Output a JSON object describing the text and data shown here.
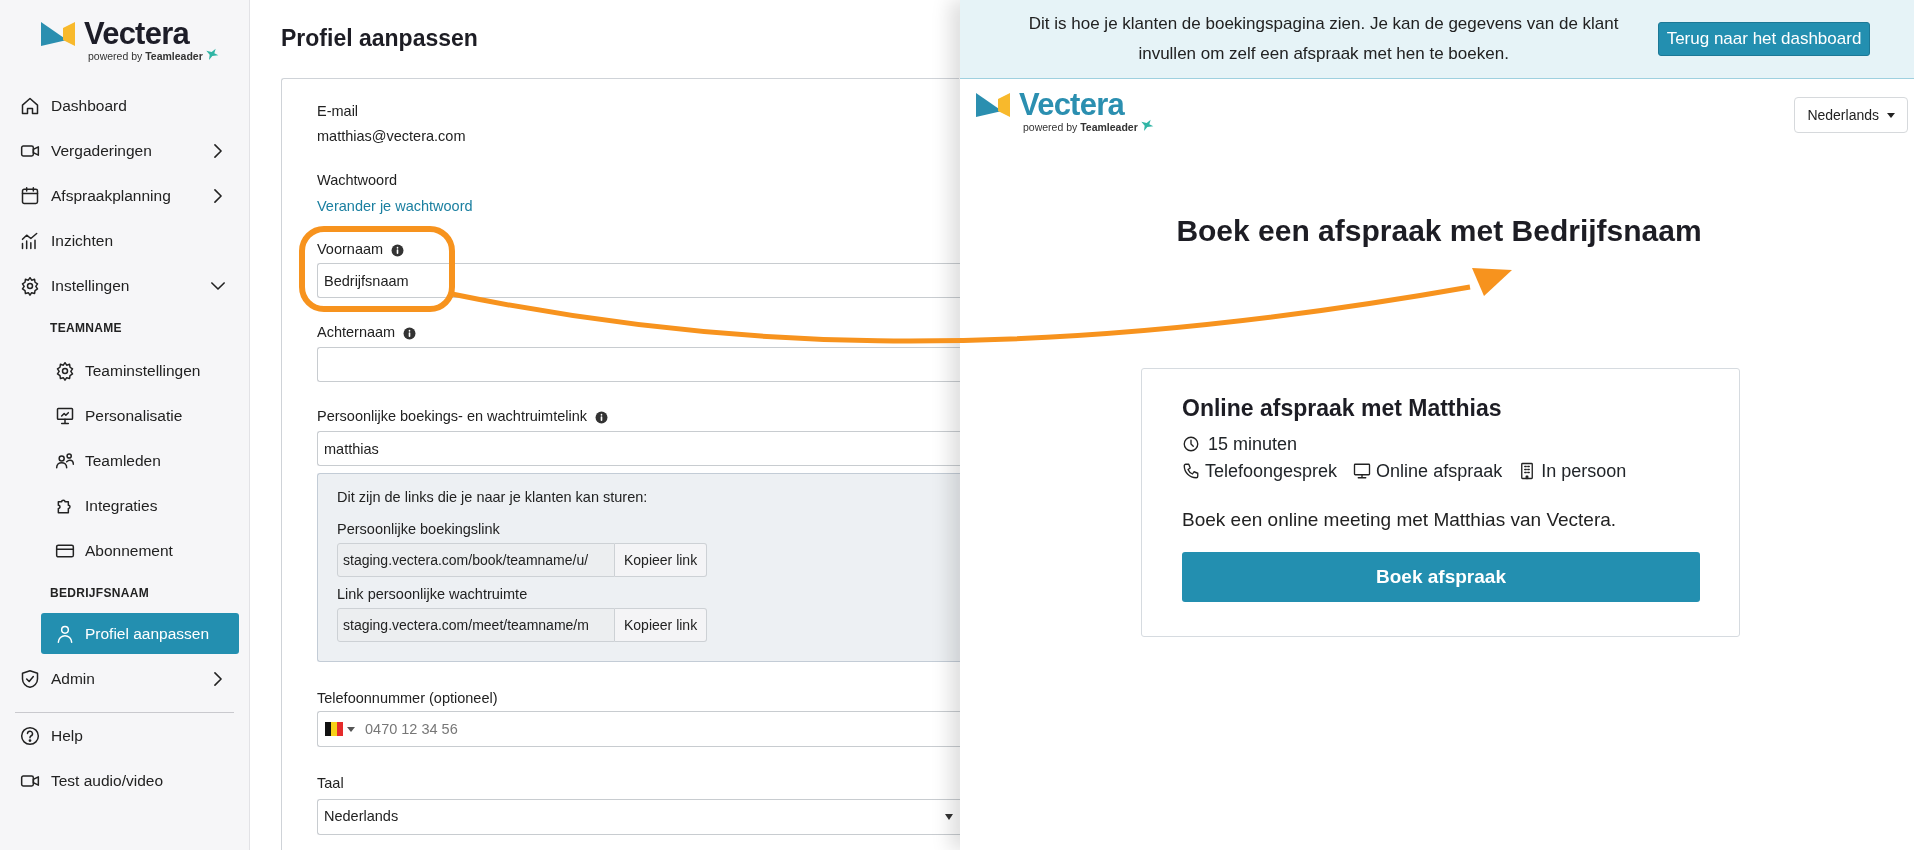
{
  "sidebar": {
    "logo": {
      "name": "Vectera",
      "tagline": "powered by **Teamleader**"
    },
    "nav": [
      {
        "label": "Dashboard",
        "selected": false
      },
      {
        "label": "Vergaderingen",
        "selected": false,
        "expanded": false
      },
      {
        "label": "Afspraakplanning",
        "selected": false,
        "expanded": false
      },
      {
        "label": "Inzichten",
        "selected": false
      },
      {
        "label": "Instellingen",
        "selected": false,
        "expanded": true,
        "children": [
          {
            "kind": "heading",
            "label": "TEAMNAME"
          },
          {
            "kind": "link",
            "label": "Teaminstellingen",
            "selected": false
          },
          {
            "kind": "link",
            "label": "Personalisatie",
            "selected": false
          },
          {
            "kind": "link",
            "label": "Teamleden",
            "selected": false
          },
          {
            "kind": "link",
            "label": "Integraties",
            "selected": false
          },
          {
            "kind": "link",
            "label": "Abonnement",
            "selected": false
          },
          {
            "kind": "heading",
            "label": "BEDRIJFSNAAM"
          },
          {
            "kind": "link",
            "label": "Profiel aanpassen",
            "selected": true
          }
        ]
      },
      {
        "label": "Admin",
        "selected": false,
        "expanded": false
      }
    ],
    "footer": [
      {
        "label": "Help",
        "selected": false
      },
      {
        "label": "Test audio/video",
        "selected": false
      }
    ]
  },
  "page_title": "Profiel aanpassen",
  "form": {
    "email": {
      "label": "E-mail",
      "value": "matthias@vectera.com"
    },
    "password": {
      "label": "Wachtwoord",
      "link": "Verander je wachtwoord"
    },
    "first_name": {
      "label": "Voornaam",
      "info": true,
      "value": "Bedrijfsnaam"
    },
    "last_name": {
      "label": "Achternaam",
      "info": true
    },
    "booking_slug": {
      "label": "Persoonlijke boekings- en wachtruimtelink",
      "info": true,
      "value": "matthias"
    },
    "links_box": {
      "intro": "Dit zijn de links die je naar je klanten kan sturen:",
      "links": [
        {
          "label": "Persoonlijke boekingslink",
          "url": "staging.vectera.com/book/teamname/u/",
          "button": "Kopieer link"
        },
        {
          "label": "Link persoonlijke wachtruimte",
          "url": "staging.vectera.com/meet/teamname/m",
          "button": "Kopieer link"
        }
      ]
    },
    "phone": {
      "label": "Telefoonnummer (optioneel)",
      "placeholder": "0470 12 34 56"
    },
    "language": {
      "label": "Taal",
      "value": "Nederlands"
    }
  },
  "preview": {
    "banner": {
      "text": "Dit is hoe je klanten de boekingspagina zien. Je kan de gegevens van de klant invullen om zelf een afspraak met hen te boeken.",
      "button": "Terug naar het dashboard"
    },
    "logo": {
      "name": "Vectera",
      "tagline": "powered by **Teamleader**"
    },
    "language": "Nederlands",
    "heading": "Boek een afspraak met Bedrijfsnaam",
    "card": {
      "title": "Online afspraak met Matthias",
      "duration": "15 minuten",
      "modes": [
        "Telefoongesprek",
        "Online afspraak",
        "In persoon"
      ],
      "description": "Boek een online meeting met Matthias van Vectera.",
      "button": "Boek afspraak"
    }
  }
}
